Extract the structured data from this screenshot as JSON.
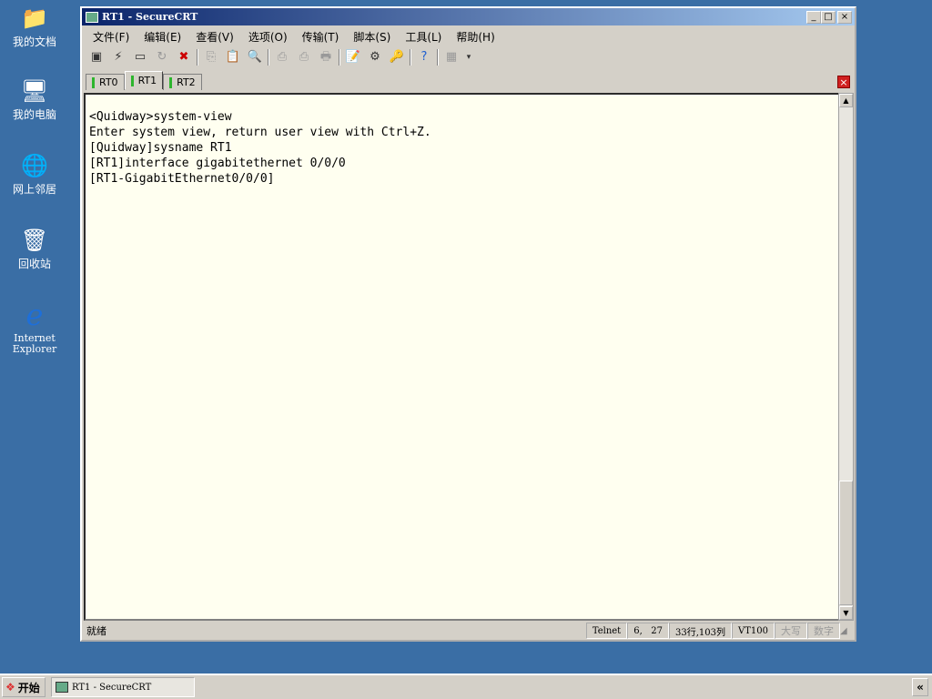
{
  "desktop": {
    "icons": [
      {
        "label": "我的文档",
        "glyph": "📁"
      },
      {
        "label": "我的电脑",
        "glyph": "🖥"
      },
      {
        "label": "网上邻居",
        "glyph": "🌐"
      },
      {
        "label": "回收站",
        "glyph": "🗑"
      },
      {
        "label": "Internet Explorer",
        "glyph": "e"
      }
    ]
  },
  "window": {
    "title": "RT1 - SecureCRT",
    "minimize": "_",
    "maximize": "□",
    "close": "×"
  },
  "menu": [
    "文件(F)",
    "编辑(E)",
    "查看(V)",
    "选项(O)",
    "传输(T)",
    "脚本(S)",
    "工具(L)",
    "帮助(H)"
  ],
  "tabs": [
    {
      "label": "RT0",
      "active": false
    },
    {
      "label": "RT1",
      "active": true
    },
    {
      "label": "RT2",
      "active": false
    }
  ],
  "terminal": {
    "lines": [
      "<Quidway>system-view",
      "Enter system view, return user view with Ctrl+Z.",
      "[Quidway]sysname RT1",
      "[RT1]interface gigabitethernet 0/0/0",
      "[RT1-GigabitEthernet0/0/0]"
    ]
  },
  "status": {
    "ready": "就绪",
    "protocol": "Telnet",
    "cursor": "6,   27",
    "size": "33行,103列",
    "emulation": "VT100",
    "caps": "大写",
    "num": "数字"
  },
  "taskbar": {
    "start": "开始",
    "task": "RT1 - SecureCRT",
    "expand": "«"
  }
}
